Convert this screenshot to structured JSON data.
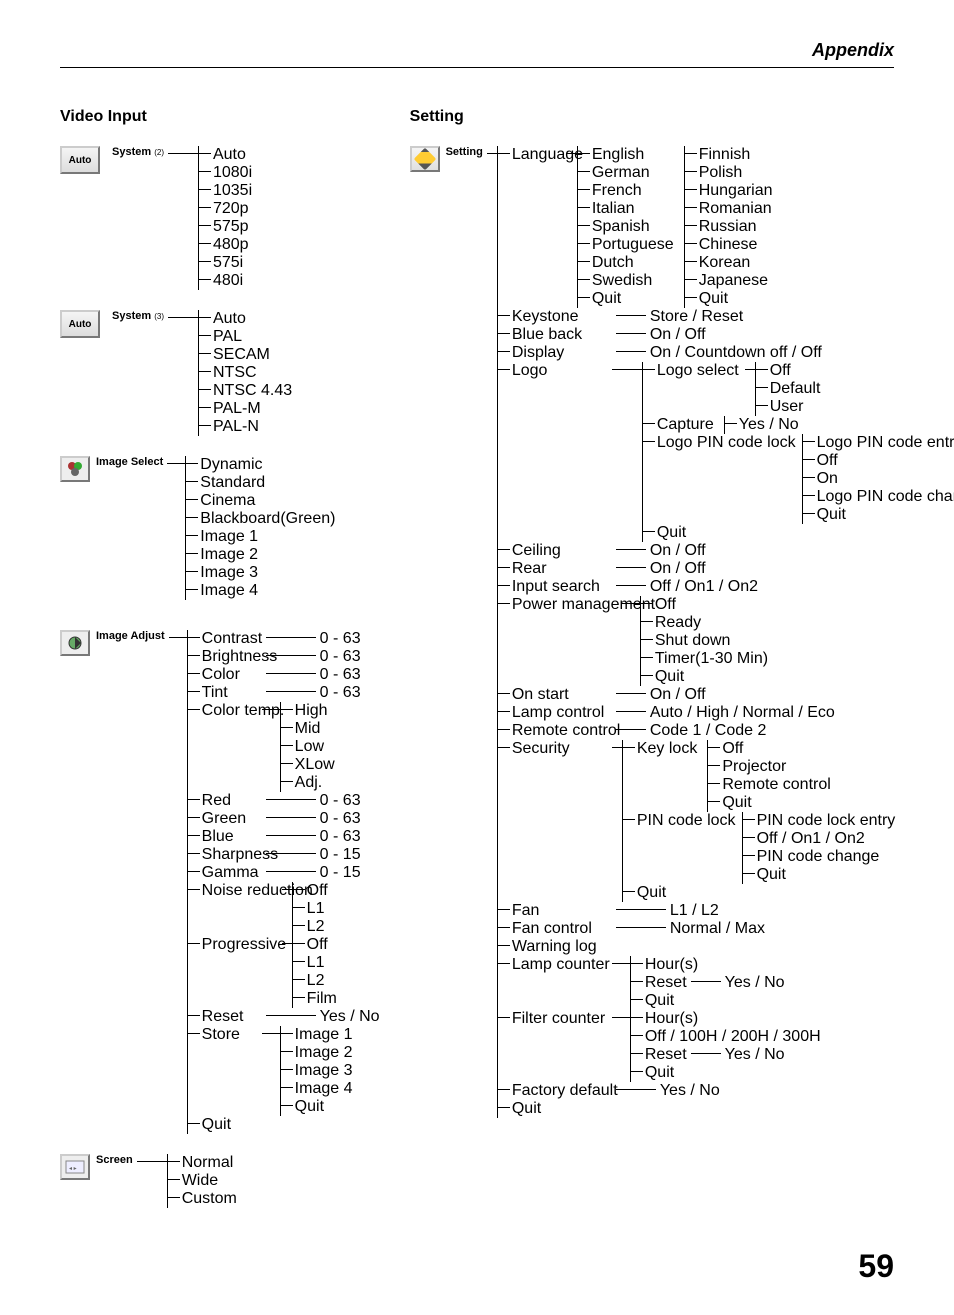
{
  "header": {
    "title": "Appendix"
  },
  "pageNumber": "59",
  "left": {
    "title": "Video Input",
    "system2": {
      "label": "System",
      "sub": "(2)",
      "box": "Auto",
      "items": [
        "Auto",
        "1080i",
        "1035i",
        "720p",
        "575p",
        "480p",
        "575i",
        "480i"
      ]
    },
    "system3": {
      "label": "System",
      "sub": "(3)",
      "box": "Auto",
      "items": [
        "Auto",
        "PAL",
        "SECAM",
        "NTSC",
        "NTSC 4.43",
        "PAL-M",
        "PAL-N"
      ]
    },
    "imageSelect": {
      "label": "Image Select",
      "items": [
        "Dynamic",
        "Standard",
        "Cinema",
        "Blackboard(Green)",
        "Image 1",
        "Image 2",
        "Image 3",
        "Image 4"
      ]
    },
    "imageAdjust": {
      "label": "Image Adjust",
      "basic": [
        {
          "k": "Contrast",
          "v": "0 - 63"
        },
        {
          "k": "Brightness",
          "v": "0 - 63"
        },
        {
          "k": "Color",
          "v": "0 - 63"
        },
        {
          "k": "Tint",
          "v": "0 - 63"
        }
      ],
      "colorTemp": {
        "k": "Color temp.",
        "items": [
          "High",
          "Mid",
          "Low",
          "XLow",
          "Adj."
        ]
      },
      "rgb": [
        {
          "k": "Red",
          "v": "0 - 63"
        },
        {
          "k": "Green",
          "v": "0 - 63"
        },
        {
          "k": "Blue",
          "v": "0 - 63"
        },
        {
          "k": "Sharpness",
          "v": "0 - 15"
        },
        {
          "k": "Gamma",
          "v": "0 - 15"
        }
      ],
      "noise": {
        "k": "Noise reduction",
        "items": [
          "Off",
          "L1",
          "L2"
        ]
      },
      "prog": {
        "k": "Progressive",
        "items": [
          "Off",
          "L1",
          "L2",
          "Film"
        ]
      },
      "reset": {
        "k": "Reset",
        "v": "Yes / No"
      },
      "store": {
        "k": "Store",
        "items": [
          "Image 1",
          "Image 2",
          "Image 3",
          "Image 4",
          "Quit"
        ]
      },
      "quit": "Quit"
    },
    "screen": {
      "label": "Screen",
      "items": [
        "Normal",
        "Wide",
        "Custom"
      ]
    }
  },
  "right": {
    "title": "Setting",
    "root": "Setting",
    "language": {
      "label": "Language",
      "col1": [
        "English",
        "German",
        "French",
        "Italian",
        "Spanish",
        "Portuguese",
        "Dutch",
        "Swedish",
        "Quit"
      ],
      "col2": [
        "Finnish",
        "Polish",
        "Hungarian",
        "Romanian",
        "Russian",
        "Chinese",
        "Korean",
        "Japanese",
        "Quit"
      ]
    },
    "keystone": {
      "k": "Keystone",
      "v": "Store / Reset"
    },
    "blueback": {
      "k": "Blue back",
      "v": "On / Off"
    },
    "display": {
      "k": "Display",
      "v": "On / Countdown off / Off"
    },
    "logo": {
      "k": "Logo",
      "logoSelect": {
        "k": "Logo select",
        "items": [
          "Off",
          "Default",
          "User"
        ]
      },
      "capture": {
        "k": "Capture",
        "v": "Yes / No"
      },
      "logoPin": {
        "k": "Logo PIN code lock",
        "items": [
          "Logo PIN code entry",
          "Off",
          "On",
          "Logo PIN code change",
          "Quit"
        ]
      },
      "quit": "Quit"
    },
    "ceiling": {
      "k": "Ceiling",
      "v": "On / Off"
    },
    "rear": {
      "k": "Rear",
      "v": "On / Off"
    },
    "inputSearch": {
      "k": "Input search",
      "v": "Off / On1 / On2"
    },
    "powerMgmt": {
      "k": "Power management",
      "items": [
        "Off",
        "Ready",
        "Shut down",
        "Timer(1-30 Min)",
        "Quit"
      ]
    },
    "onStart": {
      "k": "On start",
      "v": "On / Off"
    },
    "lampControl": {
      "k": "Lamp control",
      "v": "Auto / High / Normal / Eco"
    },
    "remote": {
      "k": "Remote control",
      "v": "Code 1 / Code 2"
    },
    "security": {
      "k": "Security",
      "keylock": {
        "k": "Key lock",
        "items": [
          "Off",
          "Projector",
          "Remote control",
          "Quit"
        ]
      },
      "pinlock": {
        "k": "PIN code lock",
        "items": [
          "PIN code lock entry",
          "Off / On1 / On2",
          "PIN code change",
          "Quit"
        ]
      },
      "quit": "Quit"
    },
    "fan": {
      "k": "Fan",
      "v": "L1 / L2"
    },
    "fanControl": {
      "k": "Fan control",
      "v": "Normal / Max"
    },
    "warningLog": {
      "k": "Warning log"
    },
    "lampCounter": {
      "k": "Lamp counter",
      "hours": "Hour(s)",
      "reset": {
        "k": "Reset",
        "v": "Yes / No"
      },
      "quit": "Quit"
    },
    "filterCounter": {
      "k": "Filter counter",
      "hours": "Hour(s)",
      "off": "Off / 100H / 200H / 300H",
      "reset": {
        "k": "Reset",
        "v": "Yes / No"
      },
      "quit": "Quit"
    },
    "factory": {
      "k": "Factory default",
      "v": "Yes / No"
    },
    "quit": "Quit"
  }
}
